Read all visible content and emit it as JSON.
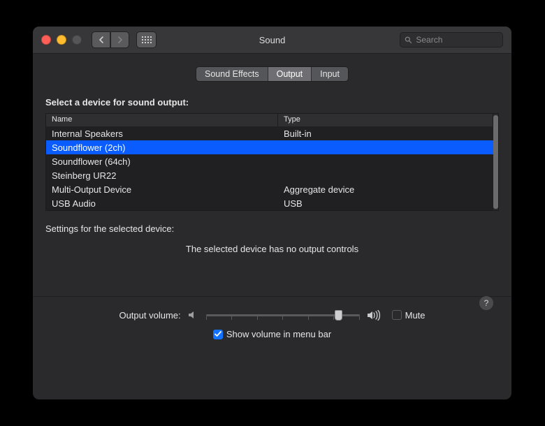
{
  "window": {
    "title": "Sound",
    "search_placeholder": "Search"
  },
  "tabs": [
    {
      "label": "Sound Effects",
      "active": false
    },
    {
      "label": "Output",
      "active": true
    },
    {
      "label": "Input",
      "active": false
    }
  ],
  "heading": "Select a device for sound output:",
  "columns": {
    "name": "Name",
    "type": "Type"
  },
  "devices": [
    {
      "name": "Internal Speakers",
      "type": "Built-in",
      "selected": false
    },
    {
      "name": "Soundflower (2ch)",
      "type": "",
      "selected": true
    },
    {
      "name": "Soundflower (64ch)",
      "type": "",
      "selected": false
    },
    {
      "name": "Steinberg UR22",
      "type": "",
      "selected": false
    },
    {
      "name": "Multi-Output Device",
      "type": "Aggregate device",
      "selected": false
    },
    {
      "name": "USB Audio",
      "type": "USB",
      "selected": false
    }
  ],
  "settings_label": "Settings for the selected device:",
  "no_controls_text": "The selected device has no output controls",
  "help_label": "?",
  "volume": {
    "label": "Output volume:",
    "value_percent": 88,
    "mute_label": "Mute",
    "mute_checked": false
  },
  "show_in_menu_bar": {
    "label": "Show volume in menu bar",
    "checked": true
  }
}
